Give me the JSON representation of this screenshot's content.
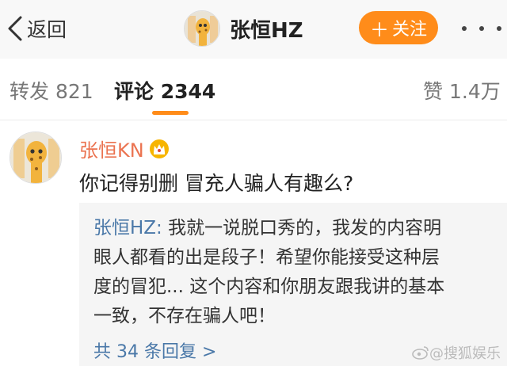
{
  "header": {
    "back_label": "返回",
    "title": "张恒HZ",
    "follow_label": "关注",
    "accent_color": "#ff8c1a"
  },
  "tabs": [
    {
      "label": "转发",
      "count": "821"
    },
    {
      "label": "评论",
      "count": "2344"
    },
    {
      "label": "赞",
      "count": "1.4万"
    }
  ],
  "comment": {
    "user": "张恒KN",
    "badge_icon": "crown-icon",
    "text": "你记得别删 冒充人骗人有趣么?",
    "reply": {
      "user": "张恒HZ:",
      "lines": [
        "我就一说脱口秀的，我发的内容明",
        "眼人都看的出是段子！希望你能接受这种层",
        "度的冒犯... 这个内容和你朋友跟我讲的基本",
        "一致，不存在骗人吧！"
      ],
      "more_label": "共 34 条回复 >"
    }
  },
  "watermark": {
    "text": "@搜狐娱乐"
  }
}
